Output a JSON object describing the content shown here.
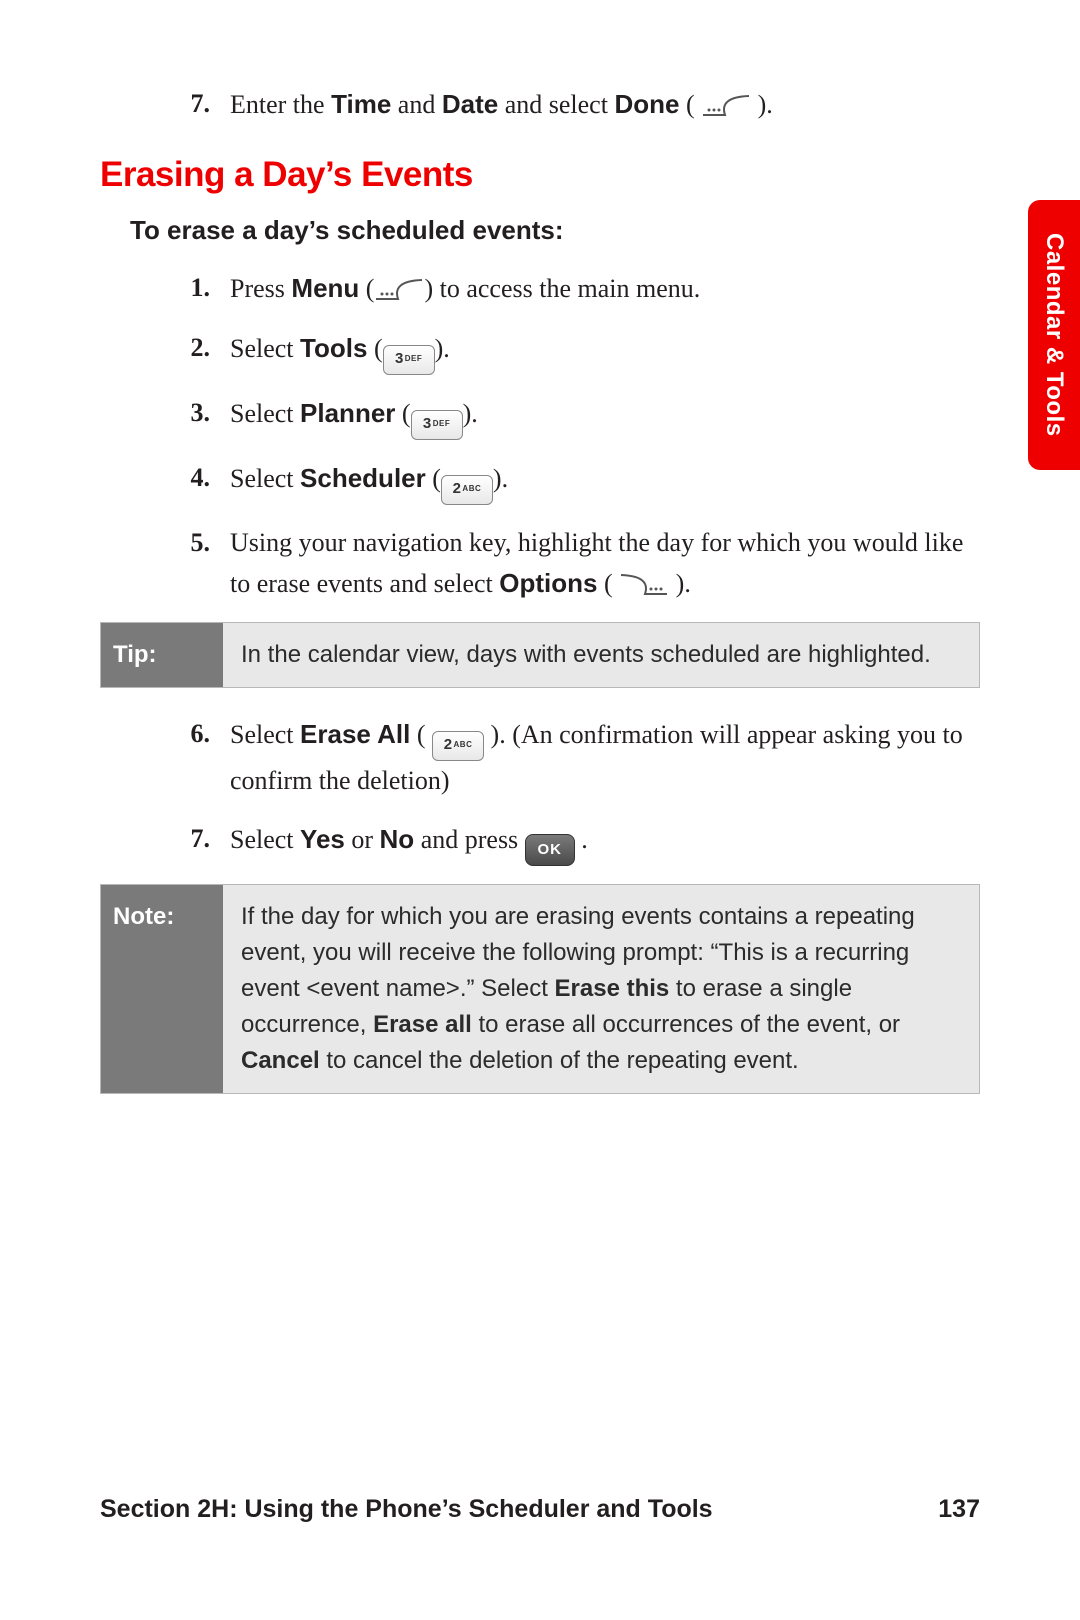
{
  "side_tab": "Calendar & Tools",
  "prev_step": {
    "num": "7.",
    "parts": [
      "Enter the ",
      "Time",
      " and ",
      "Date",
      " and select ",
      "Done",
      " (",
      ")."
    ]
  },
  "section_title": "Erasing a Day’s Events",
  "lead": "To erase a day’s scheduled events:",
  "steps": [
    {
      "num": "1.",
      "plain_before": "Press ",
      "bold": "Menu",
      "plain_after": " (",
      "icon": "softkey-left",
      "tail": ") to access the main menu."
    },
    {
      "num": "2.",
      "plain_before": "Select ",
      "bold": "Tools",
      "plain_after": " (",
      "icon": "key-3def",
      "tail": ")."
    },
    {
      "num": "3.",
      "plain_before": "Select ",
      "bold": "Planner",
      "plain_after": " (",
      "icon": "key-3def",
      "tail": ")."
    },
    {
      "num": "4.",
      "plain_before": "Select ",
      "bold": "Scheduler",
      "plain_after": " (",
      "icon": "key-2abc",
      "tail": ")."
    }
  ],
  "step5": {
    "num": "5.",
    "text_a": "Using your navigation key, highlight the day for which you would like to erase events and select ",
    "bold": "Options",
    "paren_open": " (",
    "paren_close": ")."
  },
  "tip": {
    "label": "Tip:",
    "text": "In the calendar view, days with events scheduled are highlighted."
  },
  "step6": {
    "num": "6.",
    "a": "Select ",
    "bold": "Erase All",
    "paren_open": " (",
    "paren_close": "). ",
    "tail": "(An confirmation will appear asking you to confirm the deletion)"
  },
  "step7": {
    "num": "7.",
    "a": "Select ",
    "bold1": "Yes",
    "mid": " or ",
    "bold2": "No",
    "b": " and press ",
    "period": " ."
  },
  "note": {
    "label": "Note:",
    "a": "If the day for which you are erasing events contains a repeating event, you will receive the following prompt: “This is a recurring event <event name>.” Select ",
    "b1": "Erase this",
    "c": " to erase a single occurrence, ",
    "b2": "Erase all",
    "d": " to erase all occurrences of the event, or ",
    "b3": "Cancel",
    "e": " to cancel the deletion of the repeating event."
  },
  "footer": {
    "left": "Section 2H: Using the Phone’s Scheduler and Tools",
    "right": "137"
  },
  "keys": {
    "three": {
      "dig": "3",
      "abc": "DEF"
    },
    "two": {
      "dig": "2",
      "abc": "ABC"
    },
    "ok": "OK"
  }
}
